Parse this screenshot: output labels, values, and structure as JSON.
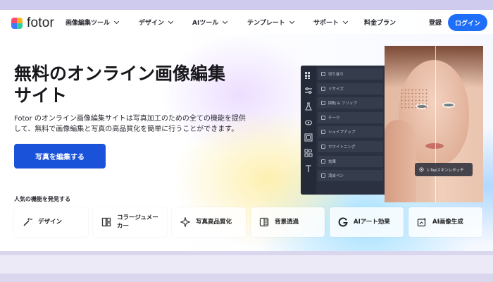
{
  "brand": {
    "name": "fotor",
    "accent": "#1f6ef7",
    "cta_color": "#1a53d9"
  },
  "nav": {
    "items": [
      {
        "label": "画像編集ツール",
        "has_dropdown": true
      },
      {
        "label": "デザイン",
        "has_dropdown": true
      },
      {
        "label": "AIツール",
        "has_dropdown": true
      },
      {
        "label": "テンプレート",
        "has_dropdown": true
      },
      {
        "label": "サポート",
        "has_dropdown": true
      },
      {
        "label": "料金プラン",
        "has_dropdown": false
      }
    ],
    "register": "登録",
    "login": "ログイン"
  },
  "hero": {
    "title_line1": "無料のオンライン画像編集",
    "title_line2": "サイト",
    "desc_line1": "Fotor のオンライン画像編集サイトは写真加工のための全ての機能を提供",
    "desc_line2": "して、無料で画像編集と写真の高品質化を簡単に行うことができます。",
    "cta": "写真を編集する"
  },
  "discover_label": "人気の機能を発見する",
  "features": [
    {
      "label": "デザイン",
      "icon": "wand-icon"
    },
    {
      "label": "コラージュメーカー",
      "icon": "collage-icon"
    },
    {
      "label": "写真高品質化",
      "icon": "sparkle-icon"
    },
    {
      "label": "背景透過",
      "icon": "transparent-bg-icon"
    },
    {
      "label": "AIアート効果",
      "icon": "ai-art-icon"
    },
    {
      "label": "AI画像生成",
      "icon": "ai-image-icon"
    }
  ],
  "editor": {
    "menu": [
      "切り抜り",
      "リサイズ",
      "回転 & フリップ",
      "チーク",
      "シェイプアップ",
      "ホワイトニング",
      "効果",
      "消去ペン"
    ],
    "chip": "1-Tapスキンレタッチ"
  }
}
